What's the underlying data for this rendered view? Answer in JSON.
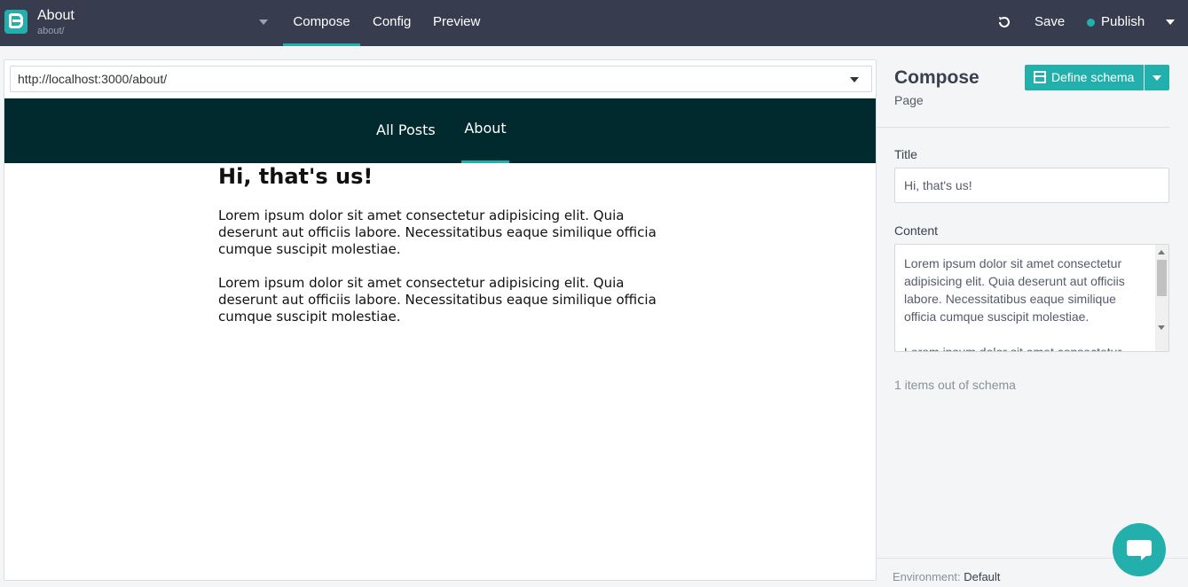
{
  "topbar": {
    "page_title": "About",
    "page_path": "about/",
    "tabs": [
      {
        "label": "Compose",
        "active": true
      },
      {
        "label": "Config",
        "active": false
      },
      {
        "label": "Preview",
        "active": false
      }
    ],
    "save_label": "Save",
    "publish_label": "Publish",
    "accent_color": "#23b0ac",
    "icons": [
      "logo-icon",
      "chevron-down-icon",
      "undo-icon",
      "status-dot-icon"
    ]
  },
  "preview": {
    "url": "http://localhost:3000/about/",
    "nav_links": [
      {
        "label": "All Posts",
        "active": false
      },
      {
        "label": "About",
        "active": true
      }
    ],
    "heading": "Hi, that's us!",
    "paragraphs": [
      "Lorem ipsum dolor sit amet consectetur adipisicing elit. Quia deserunt aut officiis labore. Necessitatibus eaque similique officia cumque suscipit molestiae.",
      "Lorem ipsum dolor sit amet consectetur adipisicing elit. Quia deserunt aut officiis labore. Necessitatibus eaque similique officia cumque suscipit molestiae."
    ],
    "nav_background": "#002a2e"
  },
  "sidebar": {
    "title": "Compose",
    "subtitle": "Page",
    "define_schema_label": "Define schema",
    "fields": [
      {
        "label": "Title",
        "value": "Hi, that's us!"
      },
      {
        "label": "Content",
        "value": "Lorem ipsum dolor sit amet consectetur adipisicing elit. Quia deserunt aut officiis labore. Necessitatibus eaque similique officia cumque suscipit molestiae.\n\nLorem ipsum dolor sit amet consectetur"
      }
    ],
    "items_note": "1 items out of schema",
    "environment_label": "Environment:",
    "environment_value": "Default"
  }
}
